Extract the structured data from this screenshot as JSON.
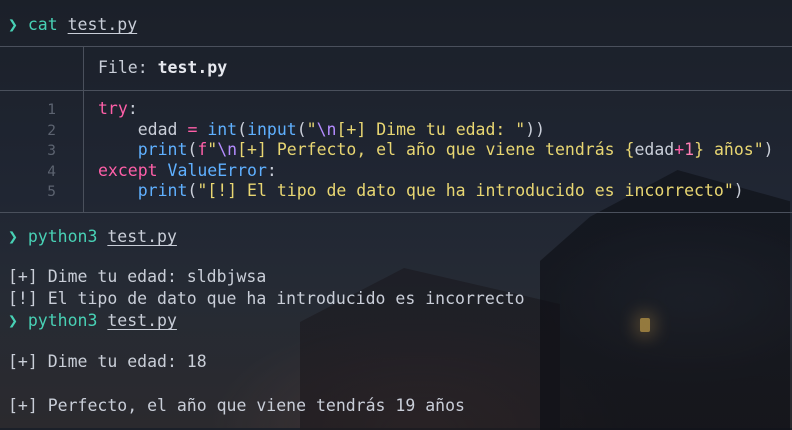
{
  "terminal": {
    "prompt_symbol": "❯",
    "cat_command": {
      "cmd": "cat",
      "arg": "test.py"
    },
    "file_header": {
      "label": "File:",
      "filename": "test.py"
    },
    "code_lines": [
      {
        "num": "1",
        "text": "try:"
      },
      {
        "num": "2",
        "text": "    edad = int(input(\"\\n[+] Dime tu edad: \"))"
      },
      {
        "num": "3",
        "text": "    print(f\"\\n[+] Perfecto, el año que viene tendrás {edad+1} años\")"
      },
      {
        "num": "4",
        "text": "except ValueError:"
      },
      {
        "num": "5",
        "text": "    print(\"[!] El tipo de dato que ha introducido es incorrecto\")"
      }
    ],
    "run1": {
      "cmd": "python3",
      "arg": "test.py"
    },
    "run1_output": [
      "[+] Dime tu edad: sldbjwsa",
      "[!] El tipo de dato que ha introducido es incorrecto"
    ],
    "run2": {
      "cmd": "python3",
      "arg": "test.py"
    },
    "run2_output": [
      "[+] Dime tu edad: 18",
      "[+] Perfecto, el año que viene tendrás 19 años"
    ]
  },
  "colors": {
    "prompt": "#48d1b5",
    "keyword": "#ff5fa8",
    "function": "#5fb0ff",
    "string": "#e8d672",
    "escape": "#b48cff"
  }
}
